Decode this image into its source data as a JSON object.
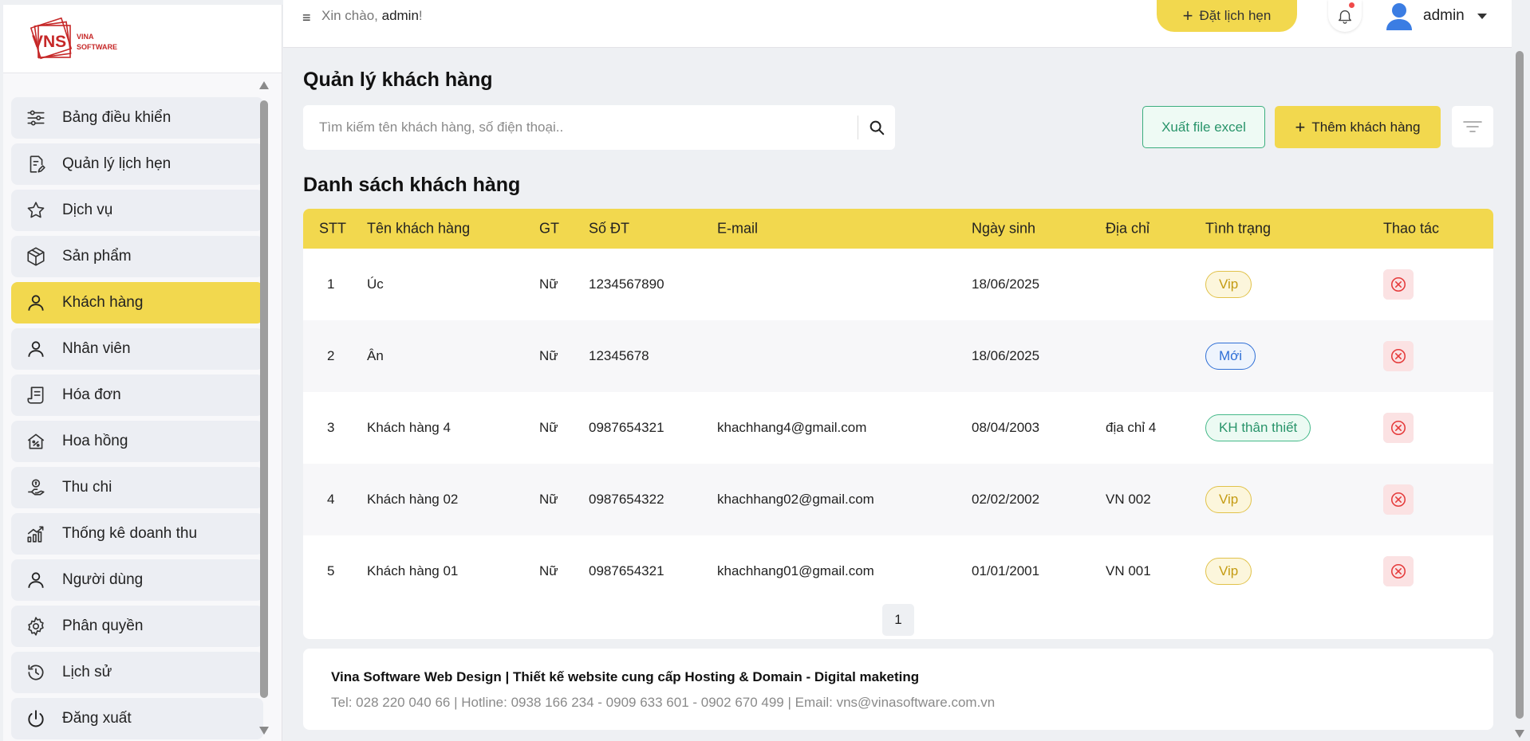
{
  "header": {
    "greeting_prefix": "Xin chào, ",
    "greeting_user": "admin",
    "greeting_suffix": "!",
    "booking_label": "Đặt lịch hẹn",
    "user_name": "admin"
  },
  "logo": {
    "mark": "VNS",
    "line1": "VINA",
    "line2": "SOFTWARE"
  },
  "sidebar": {
    "items": [
      {
        "label": "Bảng điều khiển",
        "icon": "sliders-icon"
      },
      {
        "label": "Quản lý lịch hẹn",
        "icon": "calendar-edit-icon"
      },
      {
        "label": "Dịch vụ",
        "icon": "star-icon"
      },
      {
        "label": "Sản phẩm",
        "icon": "box-icon"
      },
      {
        "label": "Khách hàng",
        "icon": "user-icon",
        "active": true
      },
      {
        "label": "Nhân viên",
        "icon": "user-icon"
      },
      {
        "label": "Hóa đơn",
        "icon": "receipt-icon"
      },
      {
        "label": "Hoa hồng",
        "icon": "commission-icon"
      },
      {
        "label": "Thu chi",
        "icon": "money-hand-icon"
      },
      {
        "label": "Thống kê doanh thu",
        "icon": "chart-up-icon"
      },
      {
        "label": "Người dùng",
        "icon": "user-icon"
      },
      {
        "label": "Phân quyền",
        "icon": "gear-icon"
      },
      {
        "label": "Lịch sử",
        "icon": "history-icon"
      },
      {
        "label": "Đăng xuất",
        "icon": "power-icon"
      }
    ]
  },
  "main": {
    "page_title": "Quản lý khách hàng",
    "search_placeholder": "Tìm kiếm tên khách hàng, số điện thoại..",
    "export_label": "Xuất file excel",
    "add_label": "Thêm khách hàng",
    "list_title": "Danh sách khách hàng",
    "columns": [
      "STT",
      "Tên khách hàng",
      "GT",
      "Số ĐT",
      "E-mail",
      "Ngày sinh",
      "Địa chỉ",
      "Tình trạng",
      "Thao tác"
    ],
    "rows": [
      {
        "stt": "1",
        "name": "Úc",
        "gt": "Nữ",
        "phone": "1234567890",
        "email": "",
        "dob": "18/06/2025",
        "addr": "",
        "status": "Vip",
        "status_type": "vip"
      },
      {
        "stt": "2",
        "name": "Ân",
        "gt": "Nữ",
        "phone": "12345678",
        "email": "",
        "dob": "18/06/2025",
        "addr": "",
        "status": "Mới",
        "status_type": "new"
      },
      {
        "stt": "3",
        "name": "Khách hàng 4",
        "gt": "Nữ",
        "phone": "0987654321",
        "email": "khachhang4@gmail.com",
        "dob": "08/04/2003",
        "addr": "địa chỉ 4",
        "status": "KH thân thiết",
        "status_type": "loyal"
      },
      {
        "stt": "4",
        "name": "Khách hàng 02",
        "gt": "Nữ",
        "phone": "0987654322",
        "email": "khachhang02@gmail.com",
        "dob": "02/02/2002",
        "addr": "VN 002",
        "status": "Vip",
        "status_type": "vip"
      },
      {
        "stt": "5",
        "name": "Khách hàng 01",
        "gt": "Nữ",
        "phone": "0987654321",
        "email": "khachhang01@gmail.com",
        "dob": "01/01/2001",
        "addr": "VN 001",
        "status": "Vip",
        "status_type": "vip"
      }
    ],
    "page_number": "1"
  },
  "footer": {
    "line1": "Vina Software Web Design | Thiết kế website cung cấp Hosting & Domain - Digital maketing",
    "line2": "Tel: 028 220 040 66 | Hotline: 0938 166 234 - 0909 633 601 - 0902 670 499 | Email: vns@vinasoftware.com.vn"
  },
  "colors": {
    "accent": "#f2d84e",
    "vip": "#c49b12",
    "new": "#2f6fd6",
    "loyal": "#28946a",
    "delete": "#e53b3b",
    "edit": "#2f6fd6"
  }
}
